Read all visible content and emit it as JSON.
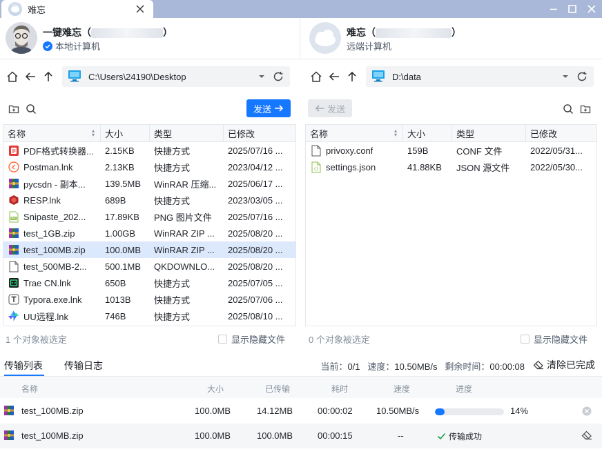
{
  "window": {
    "tab_title": "难忘",
    "colors": {
      "accent": "#1677ff",
      "titlebar": "#a9b8d8",
      "selected_row": "#dce8fb"
    }
  },
  "local": {
    "name_prefix": "一键难忘（",
    "name_suffix": "）",
    "subtitle": "本地计算机",
    "path": "C:\\Users\\24190\\Desktop",
    "send_label": "发送",
    "status": "1 个对象被选定",
    "show_hidden_label": "显示隐藏文件",
    "columns": [
      "名称",
      "大小",
      "类型",
      "已修改"
    ],
    "files": [
      {
        "icon": "pdf-icon",
        "name": "PDF格式转换器...",
        "size": "2.15KB",
        "type": "快捷方式",
        "modified": "2025/07/16 ..."
      },
      {
        "icon": "postman-icon",
        "name": "Postman.lnk",
        "size": "2.13KB",
        "type": "快捷方式",
        "modified": "2023/04/12 ..."
      },
      {
        "icon": "winrar-icon",
        "name": "pycsdn - 副本...",
        "size": "139.5MB",
        "type": "WinRAR 压缩...",
        "modified": "2025/06/17 ..."
      },
      {
        "icon": "resp-icon",
        "name": "RESP.lnk",
        "size": "689B",
        "type": "快捷方式",
        "modified": "2023/03/05 ..."
      },
      {
        "icon": "png-icon",
        "name": "Snipaste_202...",
        "size": "17.89KB",
        "type": "PNG 图片文件",
        "modified": "2025/07/16 ..."
      },
      {
        "icon": "winrar-icon",
        "name": "test_1GB.zip",
        "size": "1.00GB",
        "type": "WinRAR ZIP ...",
        "modified": "2025/08/20 ..."
      },
      {
        "icon": "winrar-icon",
        "name": "test_100MB.zip",
        "size": "100.0MB",
        "type": "WinRAR ZIP ...",
        "modified": "2025/08/20 ...",
        "selected": true
      },
      {
        "icon": "blank-file-icon",
        "name": "test_500MB-2...",
        "size": "500.1MB",
        "type": "QKDOWNLO...",
        "modified": "2025/08/20 ..."
      },
      {
        "icon": "trae-icon",
        "name": "Trae CN.lnk",
        "size": "650B",
        "type": "快捷方式",
        "modified": "2025/07/05 ..."
      },
      {
        "icon": "typora-icon",
        "name": "Typora.exe.lnk",
        "size": "1013B",
        "type": "快捷方式",
        "modified": "2025/07/06 ..."
      },
      {
        "icon": "uu-icon",
        "name": "UU远程.lnk",
        "size": "746B",
        "type": "快捷方式",
        "modified": "2025/08/10 ..."
      }
    ]
  },
  "remote": {
    "name_prefix": "难忘（",
    "name_suffix": "）",
    "subtitle": "远端计算机",
    "path": "D:\\data",
    "send_label": "发送",
    "status": "0 个对象被选定",
    "show_hidden_label": "显示隐藏文件",
    "columns": [
      "名称",
      "大小",
      "类型",
      "已修改"
    ],
    "files": [
      {
        "icon": "blank-file-icon",
        "name": "privoxy.conf",
        "size": "159B",
        "type": "CONF 文件",
        "modified": "2022/05/31..."
      },
      {
        "icon": "json-file-icon",
        "name": "settings.json",
        "size": "41.88KB",
        "type": "JSON 源文件",
        "modified": "2022/05/30..."
      }
    ]
  },
  "transfer": {
    "tabs": [
      "传输列表",
      "传输日志"
    ],
    "current_label": "当前：",
    "current_value": "0/1",
    "speed_label": "速度：",
    "speed_value": "10.50MB/s",
    "remaining_label": "剩余时间：",
    "remaining_value": "00:00:08",
    "clear_label": "清除已完成",
    "columns": [
      "名称",
      "大小",
      "已传输",
      "耗时",
      "速度",
      "进度"
    ],
    "rows": [
      {
        "name": "test_100MB.zip",
        "size": "100.0MB",
        "transferred": "14.12MB",
        "elapsed": "00:00:02",
        "speed": "10.50MB/s",
        "progress": 0.14,
        "progress_text": "14%",
        "action": "cancel-icon"
      },
      {
        "name": "test_100MB.zip",
        "size": "100.0MB",
        "transferred": "100.0MB",
        "elapsed": "00:00:15",
        "speed": "--",
        "status_text": "传输成功",
        "action": "eraser-icon"
      }
    ]
  }
}
